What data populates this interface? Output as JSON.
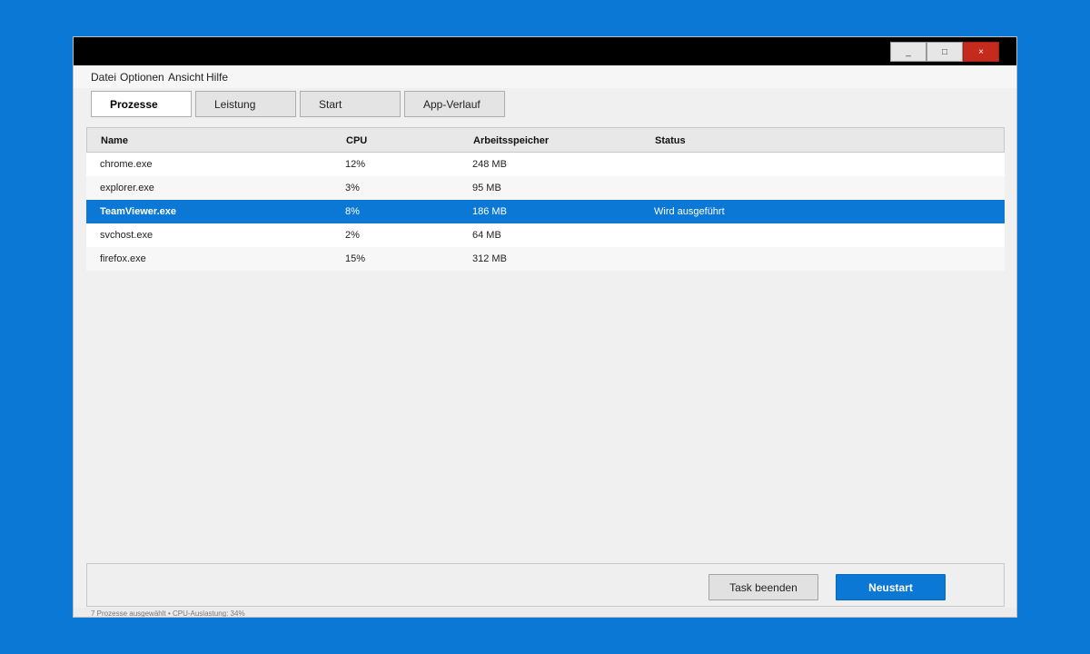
{
  "window": {
    "controls": {
      "minimize": "_",
      "maximize": "□",
      "close": "×"
    }
  },
  "menu": [
    "Datei",
    "Optionen",
    "Ansicht",
    "Hilfe"
  ],
  "tabs": [
    {
      "label": "Prozesse",
      "active": true
    },
    {
      "label": "Leistung",
      "active": false
    },
    {
      "label": "Start",
      "active": false
    },
    {
      "label": "App-Verlauf",
      "active": false
    }
  ],
  "table": {
    "columns": [
      "Name",
      "CPU",
      "Arbeitsspeicher",
      "Status"
    ],
    "rows": [
      {
        "name": "chrome.exe",
        "cpu": "12%",
        "mem": "248 MB",
        "status": ""
      },
      {
        "name": "explorer.exe",
        "cpu": "3%",
        "mem": "95 MB",
        "status": ""
      },
      {
        "name": "TeamViewer.exe",
        "cpu": "8%",
        "mem": "186 MB",
        "status": "Wird ausgeführt",
        "selected": true
      },
      {
        "name": "svchost.exe",
        "cpu": "2%",
        "mem": "64 MB",
        "status": ""
      },
      {
        "name": "firefox.exe",
        "cpu": "15%",
        "mem": "312 MB",
        "status": ""
      }
    ]
  },
  "actions": {
    "end_task": "Task beenden",
    "restart": "Neustart"
  },
  "statusbar": {
    "text": "7 Prozesse ausgewählt • CPU-Auslastung: 34%"
  },
  "colors": {
    "desktop": "#0a78d4",
    "accent": "#0a78d4",
    "close": "#c42b1c"
  }
}
